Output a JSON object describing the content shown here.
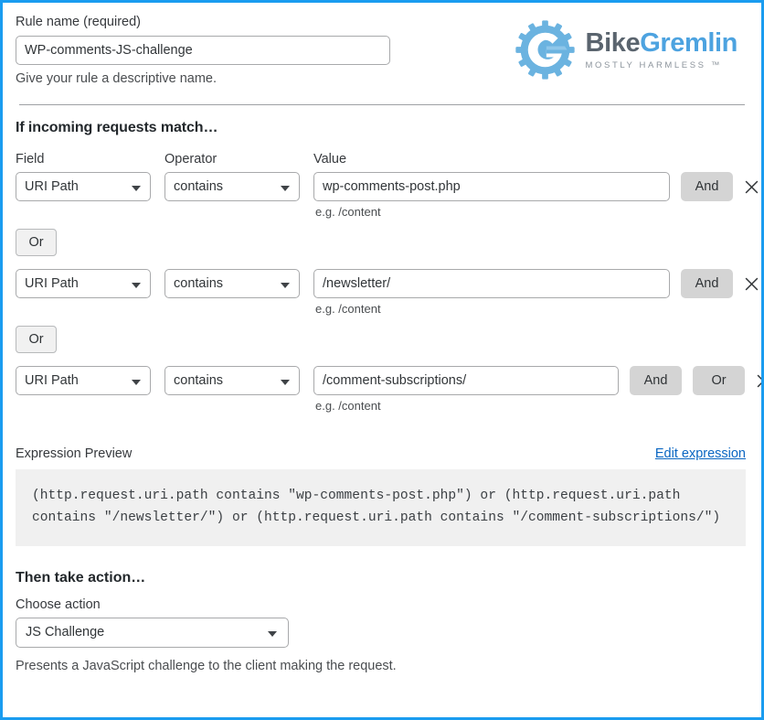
{
  "rule_name": {
    "label": "Rule name (required)",
    "value": "WP-comments-JS-challenge",
    "help": "Give your rule a descriptive name."
  },
  "logo": {
    "mark": "gear-g-logo",
    "word_part1": "Bike",
    "word_part2": "Gremlin",
    "tagline": "MOSTLY HARMLESS ™",
    "gear_color": "#6bb3e0",
    "word1_color": "#5a646e",
    "word2_color": "#4da3e0"
  },
  "match_section": {
    "heading": "If incoming requests match…",
    "columns": {
      "field": "Field",
      "operator": "Operator",
      "value": "Value"
    },
    "value_hint": "e.g. /content",
    "or_separator_label": "Or",
    "rows": [
      {
        "field": "URI Path",
        "operator": "contains",
        "value": "wp-comments-post.php",
        "buttons": [
          "And"
        ],
        "remove_icon": "close-icon"
      },
      {
        "field": "URI Path",
        "operator": "contains",
        "value": "/newsletter/",
        "buttons": [
          "And"
        ],
        "remove_icon": "close-icon"
      },
      {
        "field": "URI Path",
        "operator": "contains",
        "value": "/comment-subscriptions/",
        "buttons": [
          "And",
          "Or"
        ],
        "remove_icon": "close-icon"
      }
    ]
  },
  "expression": {
    "title": "Expression Preview",
    "edit_link": "Edit expression",
    "text": "(http.request.uri.path contains \"wp-comments-post.php\") or (http.request.uri.path contains \"/newsletter/\") or (http.request.uri.path contains \"/comment-subscriptions/\")",
    "link_color": "#0a66c2",
    "box_background": "#f0f0f0"
  },
  "action_section": {
    "heading": "Then take action…",
    "choose_label": "Choose action",
    "selected_action": "JS Challenge",
    "description": "Presents a JavaScript challenge to the client making the request."
  },
  "frame": {
    "border_color": "#1a9cf0"
  }
}
